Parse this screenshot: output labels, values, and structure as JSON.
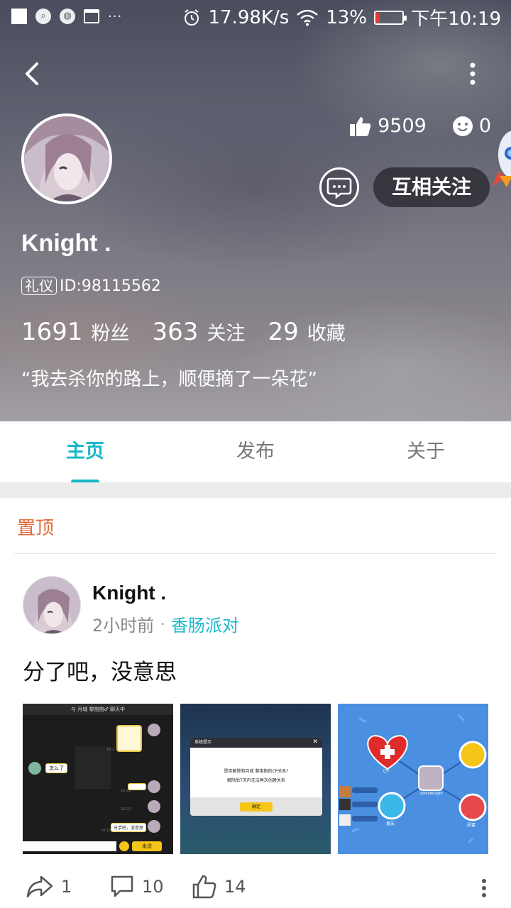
{
  "status_bar": {
    "network_speed": "17.98K/s",
    "battery_percent": "13%",
    "battery_level": 0.13,
    "time": "下午10:19"
  },
  "profile": {
    "username": "Knight .",
    "badge": "礼仪",
    "id_text": "ID:98115562",
    "likes": "9509",
    "smiles": "0",
    "follow_label": "互相关注",
    "bio": "“我去杀你的路上，顺便摘了一朵花”",
    "counts": [
      {
        "value": "1691",
        "label": "粉丝"
      },
      {
        "value": "363",
        "label": "关注"
      },
      {
        "value": "29",
        "label": "收藏"
      }
    ]
  },
  "tabs": [
    {
      "label": "主页",
      "active": true
    },
    {
      "label": "发布",
      "active": false
    },
    {
      "label": "关于",
      "active": false
    }
  ],
  "pinned_label": "置顶",
  "post": {
    "author": "Knight .",
    "time_ago": "2小时前",
    "separator": "·",
    "topic": "香肠派对",
    "text": "分了吧，没意思",
    "shares": "1",
    "comments": "10",
    "likes": "14"
  },
  "thumb1": {
    "header": "与 月城 黎抱抱♂ 聊天中",
    "msg_you": "怎么了",
    "msg_me": "分手吧，没意思",
    "send": "发送",
    "times": [
      "16:2",
      "16:21",
      "16:22",
      "16:22"
    ]
  },
  "thumb2": {
    "dialog_title": "系统提示",
    "dialog_body_1": "是否解除和月城 黎抱抱的CP关系?",
    "dialog_body_2": "解除后7天内无法再次创建关系",
    "confirm": "确定"
  },
  "thumb3": {
    "center_label": "sometKnight",
    "nodes": [
      "CP",
      "",
      "基友",
      "闺蜜"
    ]
  },
  "colors": {
    "accent": "#17b7c9",
    "pinned": "#e4693a",
    "battery_low": "#e53935"
  }
}
